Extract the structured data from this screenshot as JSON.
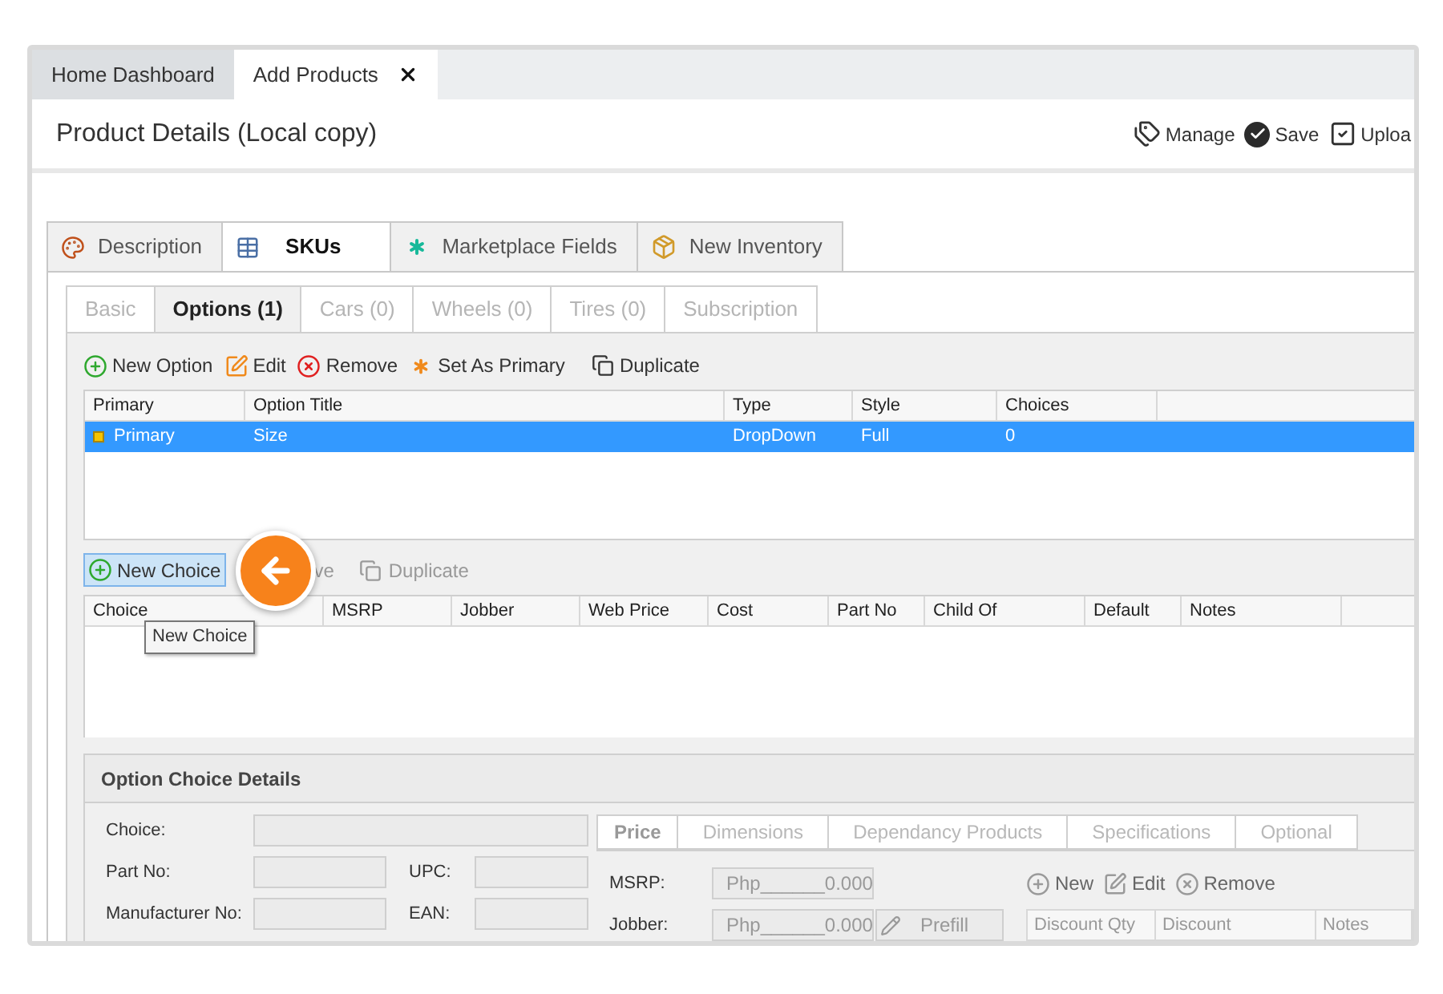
{
  "top_tabs": [
    {
      "label": "Home Dashboard",
      "selected": false,
      "closable": false
    },
    {
      "label": "Add Products",
      "selected": true,
      "closable": true
    }
  ],
  "page_title": "Product Details (Local copy)",
  "header_actions": [
    {
      "label": "Manage",
      "kind": "tags"
    },
    {
      "label": "Save",
      "kind": "check-circle"
    },
    {
      "label": "Uploa",
      "kind": "check-square"
    }
  ],
  "main_tabs": [
    {
      "label": "Description",
      "selected": false,
      "kind": "palette"
    },
    {
      "label": "SKUs",
      "selected": true,
      "kind": "grid"
    },
    {
      "label": "Marketplace Fields",
      "selected": false,
      "kind": "asterisk"
    },
    {
      "label": "New Inventory",
      "selected": false,
      "kind": "package"
    }
  ],
  "sub_tabs": [
    {
      "label": "Basic",
      "selected": false,
      "disabled": true
    },
    {
      "label": "Options (1)",
      "selected": true,
      "disabled": false
    },
    {
      "label": "Cars (0)",
      "selected": false,
      "disabled": true
    },
    {
      "label": "Wheels (0)",
      "selected": false,
      "disabled": true
    },
    {
      "label": "Tires (0)",
      "selected": false,
      "disabled": true
    },
    {
      "label": "Subscription",
      "selected": false,
      "disabled": true
    }
  ],
  "options_toolbar": [
    {
      "label": "New Option",
      "kind": "plus",
      "disabled": false
    },
    {
      "label": "Edit",
      "kind": "edit",
      "disabled": false
    },
    {
      "label": "Remove",
      "kind": "remove",
      "disabled": false
    },
    {
      "label": "Set As Primary",
      "kind": "asterisk",
      "disabled": false
    },
    {
      "label": "Duplicate",
      "kind": "copy",
      "disabled": false
    }
  ],
  "options_table": {
    "columns": [
      "Primary",
      "Option Title",
      "Type",
      "Style",
      "Choices"
    ],
    "rows": [
      {
        "cells": [
          "Primary",
          "Size",
          "DropDown",
          "Full",
          "0"
        ],
        "selected": true,
        "primary": true
      }
    ]
  },
  "choices_toolbar": {
    "new_button": {
      "label": "New Choice",
      "highlighted": true
    },
    "covered_label": "ve",
    "duplicate": {
      "label": "Duplicate",
      "disabled": true
    }
  },
  "tooltip": "New Choice",
  "choices_table": {
    "columns": [
      "Choice",
      "MSRP",
      "Jobber",
      "Web Price",
      "Cost",
      "Part No",
      "Child Of",
      "Default",
      "Notes"
    ]
  },
  "choice_details": {
    "title": "Option Choice Details",
    "fields": [
      {
        "label": "Choice:",
        "kind": "wide"
      },
      {
        "label": "Part No:",
        "kind": "pair",
        "second_label": "UPC:"
      },
      {
        "label": "Manufacturer No:",
        "kind": "pair",
        "second_label": "EAN:"
      }
    ]
  },
  "price_panel": {
    "tabs": [
      {
        "label": "Price",
        "selected": true
      },
      {
        "label": "Dimensions",
        "selected": false
      },
      {
        "label": "Dependancy Products",
        "selected": false
      },
      {
        "label": "Specifications",
        "selected": false
      },
      {
        "label": "Optional",
        "selected": false
      }
    ],
    "prices": [
      {
        "label": "MSRP:",
        "value": "Php______0.000"
      },
      {
        "label": "Jobber:",
        "value": "Php______0.000"
      }
    ],
    "prefill_button": "Prefill",
    "discount_toolbar": [
      {
        "label": "New",
        "kind": "plus"
      },
      {
        "label": "Edit",
        "kind": "edit"
      },
      {
        "label": "Remove",
        "kind": "remove"
      }
    ],
    "discount_columns": [
      "Discount Qty",
      "Discount",
      "Notes"
    ]
  }
}
